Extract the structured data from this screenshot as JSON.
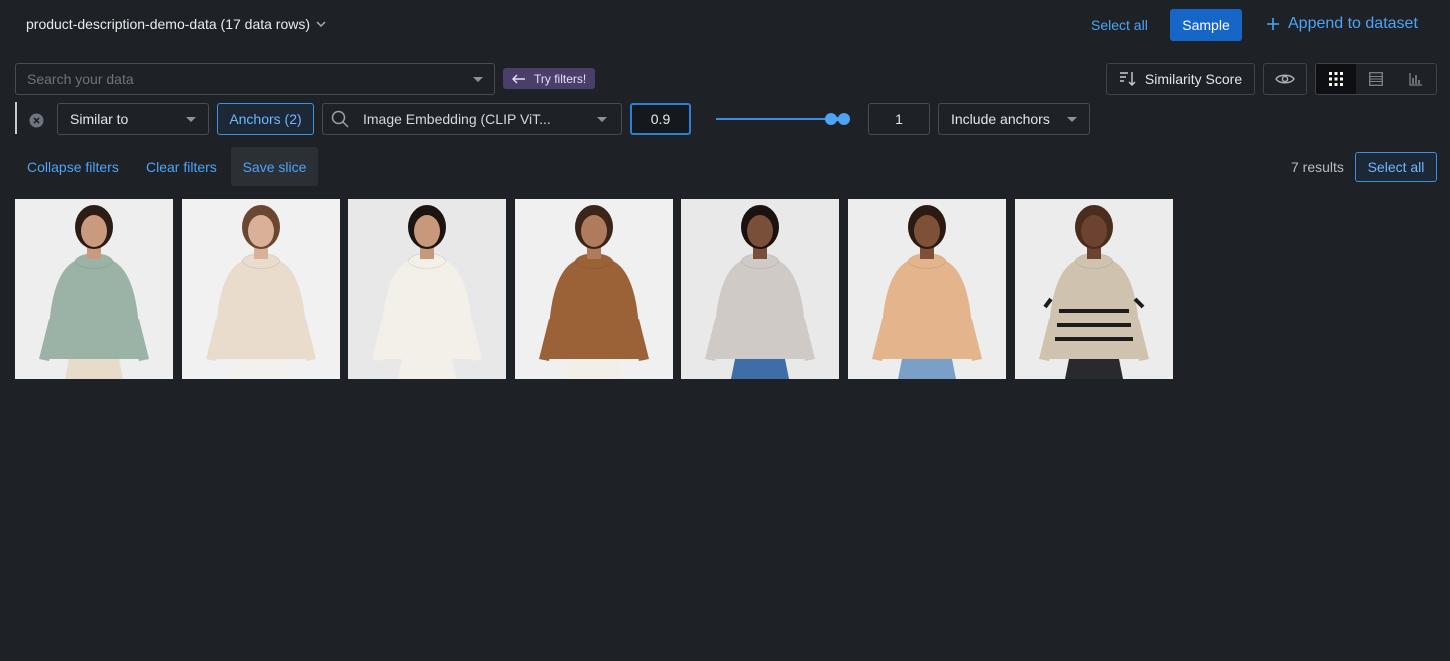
{
  "header": {
    "dataset_title": "product-description-demo-data (17 data rows)",
    "select_all_label": "Select all",
    "sample_label": "Sample",
    "append_label": "Append to dataset"
  },
  "search": {
    "placeholder": "Search your data",
    "try_filters_label": "Try filters!"
  },
  "toolbar": {
    "sort_label": "Similarity Score",
    "view_modes": [
      "grid",
      "list",
      "chart"
    ],
    "active_view": "grid"
  },
  "filter": {
    "operator": "Similar to",
    "anchors_label": "Anchors (2)",
    "embedding": "Image Embedding (CLIP ViT...",
    "lower_threshold": "0.9",
    "upper_threshold": "1",
    "range_min_fraction": 0.9,
    "range_max_fraction": 1.0,
    "include_anchors_label": "Include anchors"
  },
  "actions": {
    "collapse_label": "Collapse filters",
    "clear_label": "Clear filters",
    "save_slice_label": "Save slice",
    "results_count": "7 results",
    "select_all_label": "Select all"
  },
  "gallery": {
    "items": [
      {
        "sweater": "sage green cable-knit turtleneck",
        "sweater_color": "#9bb3a6",
        "pants_color": "#e6dcc9",
        "skin": "#c99a7d",
        "hair": "#2b1d16",
        "bg": "#eeeeee"
      },
      {
        "sweater": "cream half-zip knit",
        "sweater_color": "#e9dccd",
        "pants_color": "#f3f1ee",
        "skin": "#d9b199",
        "hair": "#6b4630",
        "bg": "#f1f1f1"
      },
      {
        "sweater": "white cable-knit turtleneck",
        "sweater_color": "#f3f0ea",
        "pants_color": "#f3f0ea",
        "skin": "#c8987a",
        "hair": "#1c1411",
        "bg": "#e8e8e8"
      },
      {
        "sweater": "brown crochet knit",
        "sweater_color": "#9b6238",
        "pants_color": "#f2efe9",
        "skin": "#b07b5c",
        "hair": "#3b2519",
        "bg": "#f0f0f0"
      },
      {
        "sweater": "grey ribbed turtleneck",
        "sweater_color": "#cfcac6",
        "pants_color": "#3e6ea8",
        "skin": "#7a4f3a",
        "hair": "#1a1210",
        "bg": "#e9e9e9"
      },
      {
        "sweater": "camel roll-neck",
        "sweater_color": "#e4b58c",
        "pants_color": "#7aa0c8",
        "skin": "#7d5037",
        "hair": "#2a1a12",
        "bg": "#ededed"
      },
      {
        "sweater": "beige striped knit",
        "sweater_color": "#cfc2ae",
        "pants_color": "#2a2a2e",
        "skin": "#6b4330",
        "hair": "#4a2d1c",
        "bg": "#ececec"
      }
    ]
  }
}
